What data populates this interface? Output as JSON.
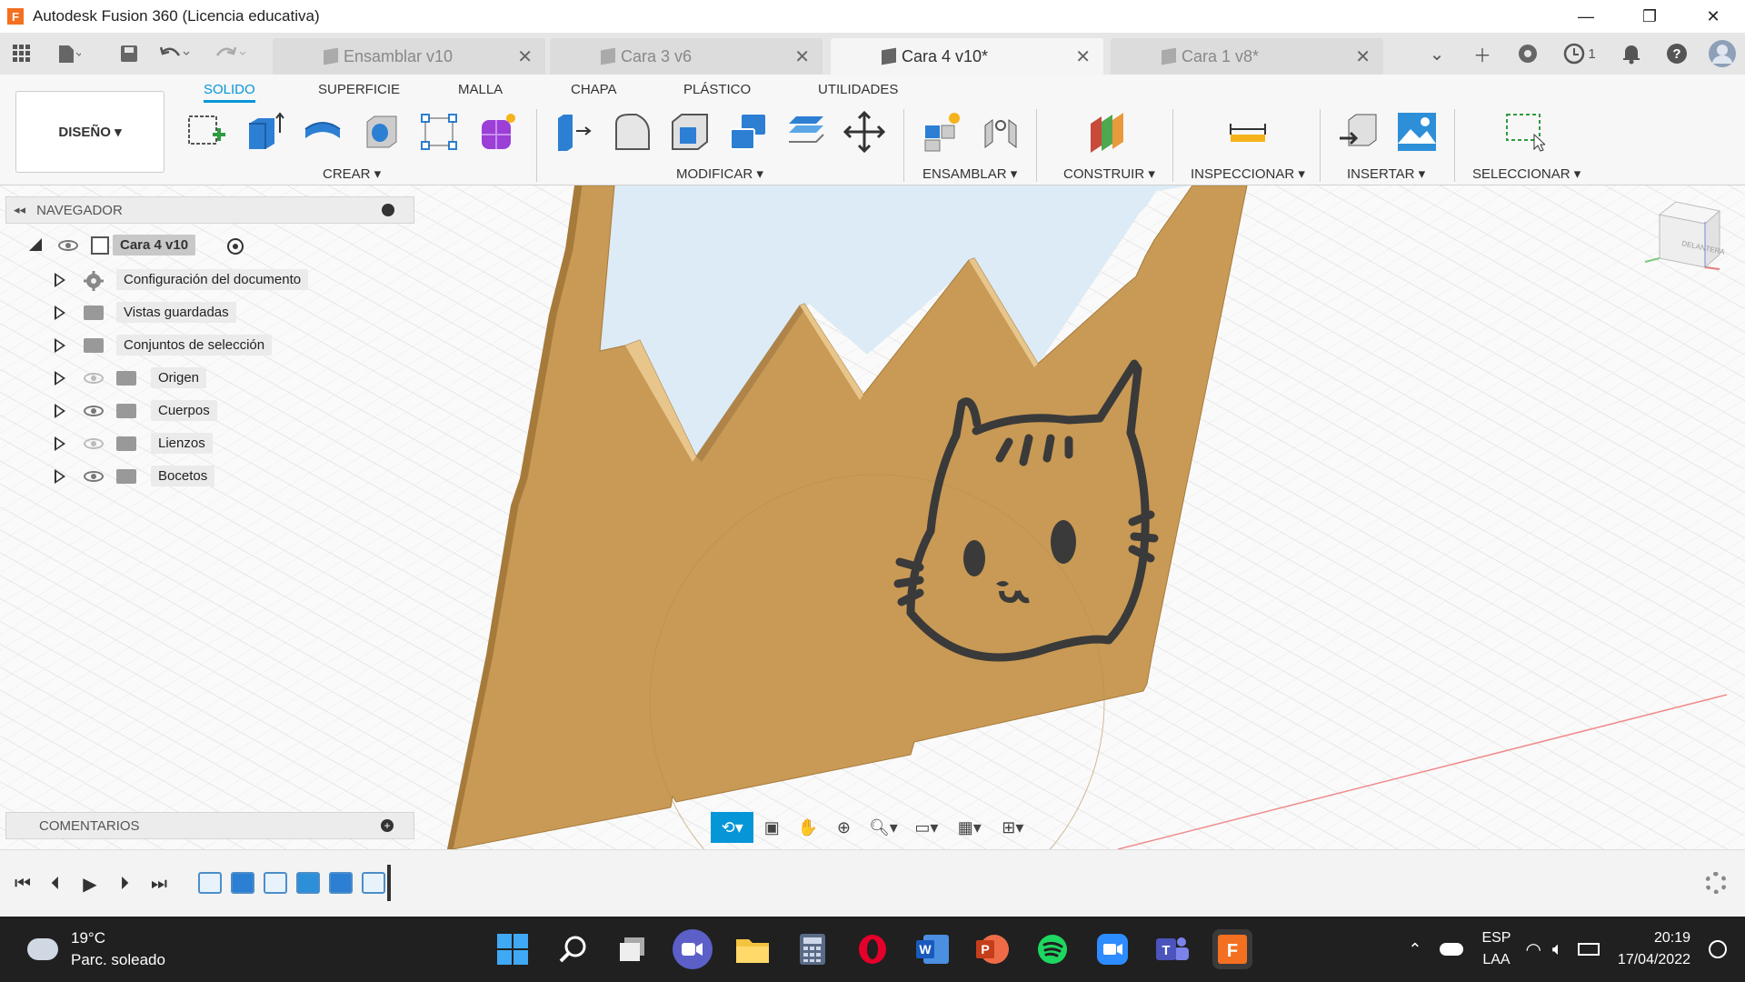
{
  "window": {
    "title": "Autodesk Fusion 360 (Licencia educativa)",
    "app_logo": "F",
    "minimize": "—",
    "restore": "❐",
    "close": "✕"
  },
  "tabs": [
    {
      "label": "Ensamblar v10",
      "active": false
    },
    {
      "label": "Cara 3 v6",
      "active": false
    },
    {
      "label": "Cara 4 v10*",
      "active": true
    },
    {
      "label": "Cara 1 v8*",
      "active": false
    }
  ],
  "tab_close": "✕",
  "tabbar_right": {
    "jobs_count": "1"
  },
  "ribbon": {
    "workspace": "DISEÑO ▾",
    "tabs": [
      "SOLIDO",
      "SUPERFICIE",
      "MALLA",
      "CHAPA",
      "PLÁSTICO",
      "UTILIDADES"
    ],
    "groups": [
      "CREAR ▾",
      "MODIFICAR ▾",
      "ENSAMBLAR ▾",
      "CONSTRUIR ▾",
      "INSPECCIONAR ▾",
      "INSERTAR ▾",
      "SELECCIONAR ▾"
    ]
  },
  "browser": {
    "header": "NAVEGADOR",
    "root": "Cara 4 v10",
    "items": [
      {
        "label": "Configuración del documento",
        "icon": "gear-icon",
        "eye": "none"
      },
      {
        "label": "Vistas guardadas",
        "icon": "folder-icon",
        "eye": "none"
      },
      {
        "label": "Conjuntos de selección",
        "icon": "folder-icon",
        "eye": "none"
      },
      {
        "label": "Origen",
        "icon": "folder-icon",
        "eye": "hidden"
      },
      {
        "label": "Cuerpos",
        "icon": "folder-icon",
        "eye": "visible"
      },
      {
        "label": "Lienzos",
        "icon": "folder-icon",
        "eye": "hidden"
      },
      {
        "label": "Bocetos",
        "icon": "folder-icon",
        "eye": "visible"
      }
    ]
  },
  "comments": {
    "header": "COMENTARIOS"
  },
  "viewcube": {
    "face": "DELANTERA"
  },
  "taskbar": {
    "weather_temp": "19°C",
    "weather_desc": "Parc. soleado",
    "lang_top": "ESP",
    "lang_bottom": "LAA",
    "time": "20:19",
    "date": "17/04/2022"
  },
  "colors": {
    "accent": "#0696d7",
    "body": "#c99a55",
    "cat_outline": "#3a3a3a",
    "taskbar": "#202020"
  }
}
